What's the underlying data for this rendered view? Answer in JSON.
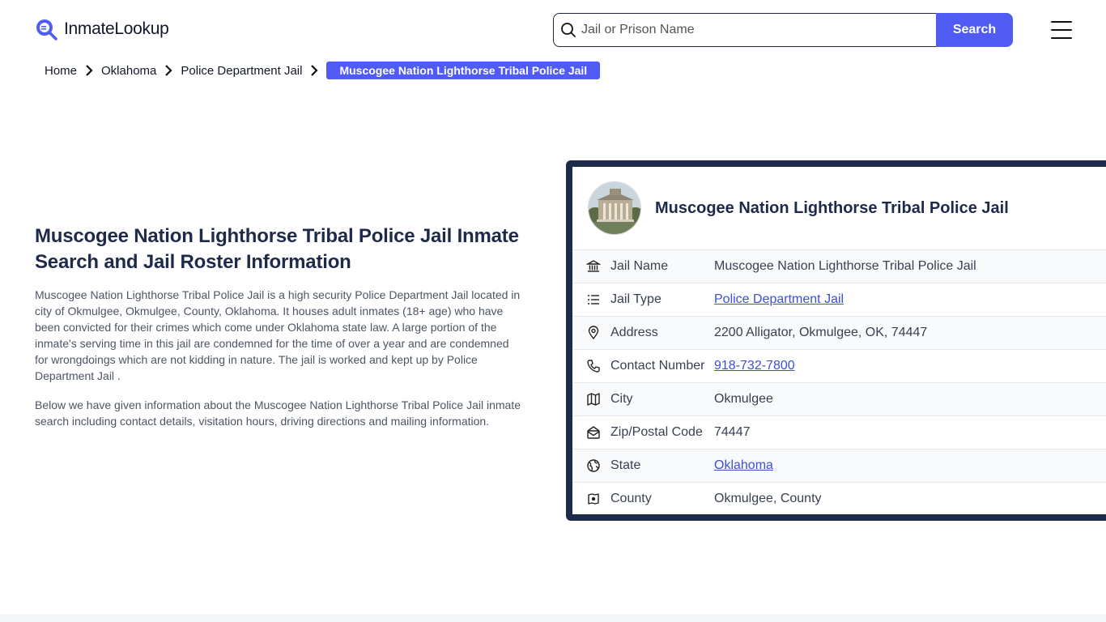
{
  "header": {
    "logo_text": "InmateLookup",
    "search_placeholder": "Jail or Prison Name",
    "search_button_label": "Search"
  },
  "breadcrumb": {
    "items": [
      "Home",
      "Oklahoma",
      "Police Department Jail"
    ],
    "current": "Muscogee Nation Lighthorse Tribal Police Jail"
  },
  "main": {
    "heading": "Muscogee Nation Lighthorse Tribal Police Jail Inmate Search and Jail Roster Information",
    "paragraph1": "Muscogee Nation Lighthorse Tribal Police Jail is a high security Police Department Jail located in city of Okmulgee, Okmulgee, County, Oklahoma. It houses adult inmates (18+ age) who have been convicted for their crimes which come under Oklahoma state law. A large portion of the inmate's serving time in this jail are condemned for the time of over a year and are condemned for wrongdoings which are not kidding in nature. The jail is worked and kept up by Police Department Jail .",
    "paragraph2": "Below we have given information about the Muscogee Nation Lighthorse Tribal Police Jail inmate search including contact details, visitation hours, driving directions and mailing information."
  },
  "card": {
    "title": "Muscogee Nation Lighthorse Tribal Police Jail",
    "rows": [
      {
        "icon": "building-icon",
        "label": "Jail Name",
        "value": "Muscogee Nation Lighthorse Tribal Police Jail",
        "link": false
      },
      {
        "icon": "list-icon",
        "label": "Jail Type",
        "value": "Police Department Jail",
        "link": true
      },
      {
        "icon": "map-pin-icon",
        "label": "Address",
        "value": "2200 Alligator, Okmulgee, OK, 74447",
        "link": false
      },
      {
        "icon": "phone-icon",
        "label": "Contact Number",
        "value": "918-732-7800",
        "link": true
      },
      {
        "icon": "map-icon",
        "label": "City",
        "value": "Okmulgee",
        "link": false
      },
      {
        "icon": "mail-icon",
        "label": "Zip/Postal Code",
        "value": "74447",
        "link": false
      },
      {
        "icon": "globe-icon",
        "label": "State",
        "value": "Oklahoma",
        "link": true
      },
      {
        "icon": "county-icon",
        "label": "County",
        "value": "Okmulgee, County",
        "link": false
      }
    ]
  },
  "colors": {
    "accent": "#4f5bf2",
    "navy": "#1e2a4a",
    "link": "#3b4fd8"
  }
}
